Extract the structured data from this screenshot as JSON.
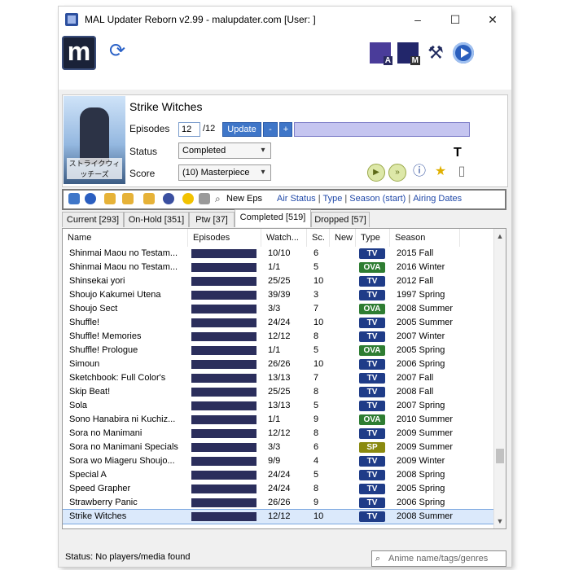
{
  "window": {
    "title": "MAL Updater Reborn v2.99 - malupdater.com [User:          ]",
    "min": "–",
    "max": "☐",
    "close": "✕"
  },
  "toolbar": {
    "logo": "m"
  },
  "details": {
    "title": "Strike Witches",
    "cover_text": "ストライクウィッチーズ",
    "episodes_label": "Episodes",
    "episodes_value": "12",
    "episodes_total": "/12",
    "update_label": "Update",
    "minus_label": "-",
    "plus_label": "+",
    "status_label": "Status",
    "status_value": "Completed",
    "score_label": "Score",
    "score_value": "(10) Masterpiece"
  },
  "filterbar": {
    "new_eps": "New Eps",
    "links": [
      "Air Status",
      "Type",
      "Season (start)",
      "Airing Dates"
    ]
  },
  "tabs": [
    {
      "label": "Current [293]"
    },
    {
      "label": "On-Hold [351]"
    },
    {
      "label": "Ptw [37]"
    },
    {
      "label": "Completed [519]"
    },
    {
      "label": "Dropped [57]"
    }
  ],
  "columns": [
    "Name",
    "Episodes",
    "Watch...",
    "Sc.",
    "New",
    "Type",
    "Season"
  ],
  "rows": [
    {
      "name": "Shinmai Maou no Testam...",
      "watched": "10/10",
      "score": "6",
      "type": "TV",
      "season": "2015 Fall"
    },
    {
      "name": "Shinmai Maou no Testam...",
      "watched": "1/1",
      "score": "5",
      "type": "OVA",
      "season": "2016 Winter"
    },
    {
      "name": "Shinsekai yori",
      "watched": "25/25",
      "score": "10",
      "type": "TV",
      "season": "2012 Fall"
    },
    {
      "name": "Shoujo Kakumei Utena",
      "watched": "39/39",
      "score": "3",
      "type": "TV",
      "season": "1997 Spring"
    },
    {
      "name": "Shoujo Sect",
      "watched": "3/3",
      "score": "7",
      "type": "OVA",
      "season": "2008 Summer"
    },
    {
      "name": "Shuffle!",
      "watched": "24/24",
      "score": "10",
      "type": "TV",
      "season": "2005 Summer"
    },
    {
      "name": "Shuffle! Memories",
      "watched": "12/12",
      "score": "8",
      "type": "TV",
      "season": "2007 Winter"
    },
    {
      "name": "Shuffle! Prologue",
      "watched": "1/1",
      "score": "5",
      "type": "OVA",
      "season": "2005 Spring"
    },
    {
      "name": "Simoun",
      "watched": "26/26",
      "score": "10",
      "type": "TV",
      "season": "2006 Spring"
    },
    {
      "name": "Sketchbook: Full Color's",
      "watched": "13/13",
      "score": "7",
      "type": "TV",
      "season": "2007 Fall"
    },
    {
      "name": "Skip Beat!",
      "watched": "25/25",
      "score": "8",
      "type": "TV",
      "season": "2008 Fall"
    },
    {
      "name": "Sola",
      "watched": "13/13",
      "score": "5",
      "type": "TV",
      "season": "2007 Spring"
    },
    {
      "name": "Sono Hanabira ni Kuchiz...",
      "watched": "1/1",
      "score": "9",
      "type": "OVA",
      "season": "2010 Summer"
    },
    {
      "name": "Sora no Manimani",
      "watched": "12/12",
      "score": "8",
      "type": "TV",
      "season": "2009 Summer"
    },
    {
      "name": "Sora no Manimani Specials",
      "watched": "3/3",
      "score": "6",
      "type": "SP",
      "season": "2009 Summer"
    },
    {
      "name": "Sora wo Miageru Shoujo...",
      "watched": "9/9",
      "score": "4",
      "type": "TV",
      "season": "2009 Winter"
    },
    {
      "name": "Special A",
      "watched": "24/24",
      "score": "5",
      "type": "TV",
      "season": "2008 Spring"
    },
    {
      "name": "Speed Grapher",
      "watched": "24/24",
      "score": "8",
      "type": "TV",
      "season": "2005 Spring"
    },
    {
      "name": "Strawberry Panic",
      "watched": "26/26",
      "score": "9",
      "type": "TV",
      "season": "2006 Spring"
    },
    {
      "name": "Strike Witches",
      "watched": "12/12",
      "score": "10",
      "type": "TV",
      "season": "2008 Summer",
      "selected": true
    }
  ],
  "type_colors": {
    "TV": "#1f3c88",
    "OVA": "#2e7d32",
    "SP": "#8a8a10"
  },
  "statusbar": {
    "text": "Status: No players/media found",
    "search_placeholder": "Anime name/tags/genres"
  }
}
